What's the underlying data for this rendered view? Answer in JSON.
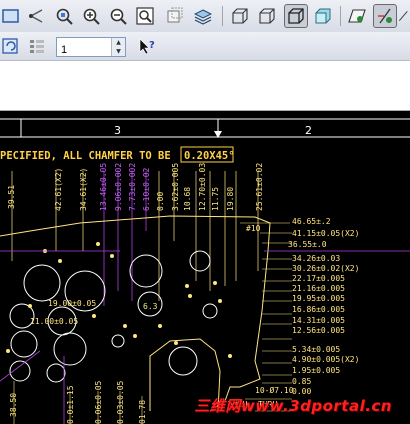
{
  "toolbar": {
    "icons": [
      "view-fit-icon",
      "nodes-icon",
      "repaint-icon",
      "zoom-in-icon",
      "zoom-out-icon",
      "zoom-window-icon",
      "views-icon",
      "layers-icon",
      "wireframe-icon",
      "hidden-line-icon",
      "no-hidden-icon",
      "shaded-icon",
      "datum-plane-icon",
      "spin-center-icon",
      "refresh-icon",
      "filter-icon",
      "whats-this-icon"
    ]
  },
  "sheet": {
    "value": "1"
  },
  "drawing": {
    "zone_numbers": [
      "3",
      "2"
    ],
    "note_text": "PECIFIED, ALL CHAMFER TO BE",
    "note_value": "0.20X45°",
    "right_dims": [
      "46.65±.2",
      "41.15±0.05(X2)",
      "36.55±.0",
      "34.26±0.03",
      "30.26±0.02(X2)",
      "22.17±0.005",
      "21.16±0.005",
      "19.95±0.005",
      "16.86±0.005",
      "14.31±0.005",
      "12.56±0.005",
      "5.34±0.005",
      "4.90±0.005(X2)",
      "1.95±0.005",
      "0.85",
      "0.00"
    ],
    "top_dims": [
      "39.51",
      "42.61(X2)",
      "34.61(X2)",
      "13.46±0.05",
      "9.06±0.002",
      "7.73±0.002",
      "6.10±0.02",
      "0.00",
      "3.62±0.005",
      "10.68",
      "12.70±0.03",
      "11.75",
      "19.80",
      "25.61±0.02"
    ],
    "hole_labels": [
      "19.00±0.05",
      "11.00±0.05",
      "6.3",
      "#10"
    ],
    "bottom_dims": [
      "38.50",
      "0.0±1.15",
      "0.06±0.05",
      "0.03±0.05",
      "01.78",
      "THRU",
      "THRU",
      "10-Ø7.10"
    ]
  },
  "watermark": "三维网www.3dportal.cn"
}
